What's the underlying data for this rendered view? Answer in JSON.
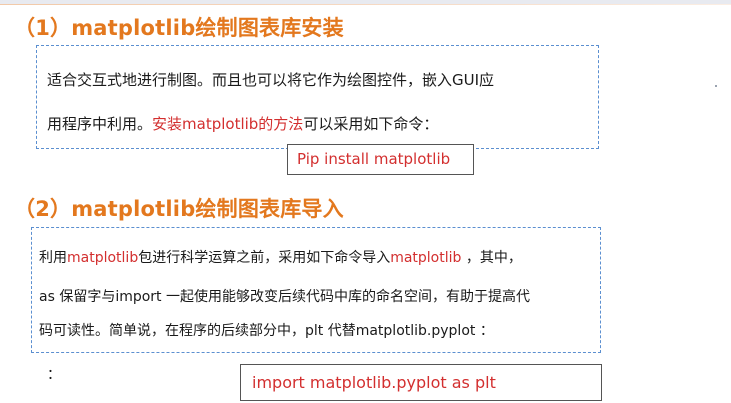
{
  "section1": {
    "title": "（1）matplotlib绘制图表库安装",
    "line1": "适合交互式地进行制图。而且也可以将它作为绘图控件，嵌入GUI应",
    "line2_a": "用程序中利用。",
    "line2_red": "安装matplotlib的方法",
    "line2_b": "可以采用如下命令：",
    "command": "Pip install matplotlib"
  },
  "section2": {
    "title": "（2）matplotlib绘制图表库导入",
    "line1_a": "利用",
    "line1_red1": "matplotlib",
    "line1_b": "包进行科学运算之前，采用如下命令导入",
    "line1_red2": "matplotlib",
    "line1_c": " ，其中，",
    "line2": "as 保留字与import 一起使用能够改变后续代码中库的命名空间，有助于提高代",
    "line3": "码可读性。简单说，在程序的后续部分中，plt 代替matplotlib.pyplot ：",
    "line4": "：",
    "command": "import matplotlib.pyplot as plt"
  },
  "colors": {
    "heading": "#e3781e",
    "highlight": "#d32f2f",
    "dashed_border": "#5b8fd0"
  }
}
